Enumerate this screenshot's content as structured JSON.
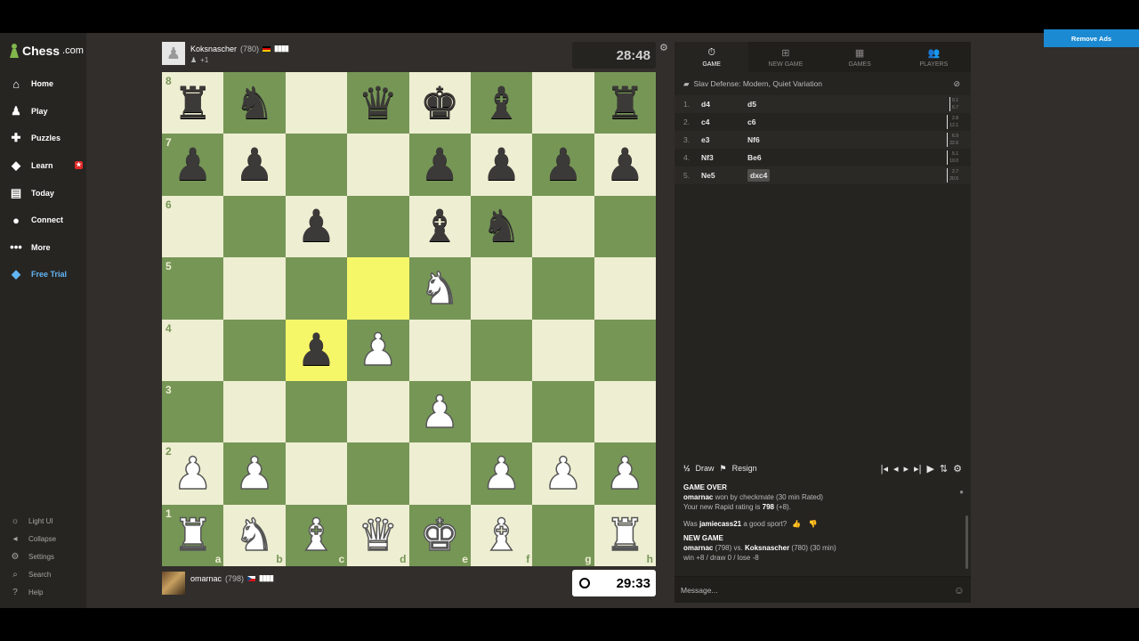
{
  "brand": {
    "name": "Chess",
    "suffix": ".com"
  },
  "nav": [
    {
      "icon": "home-icon",
      "glyph": "⌂",
      "label": "Home"
    },
    {
      "icon": "play-icon",
      "glyph": "♟",
      "label": "Play"
    },
    {
      "icon": "puzzles-icon",
      "glyph": "✚",
      "label": "Puzzles"
    },
    {
      "icon": "learn-icon",
      "glyph": "◆",
      "label": "Learn"
    },
    {
      "icon": "today-icon",
      "glyph": "▤",
      "label": "Today"
    },
    {
      "icon": "connect-icon",
      "glyph": "●",
      "label": "Connect"
    },
    {
      "icon": "more-icon",
      "glyph": "•••",
      "label": "More"
    },
    {
      "icon": "diamond-icon",
      "glyph": "◆",
      "label": "Free Trial"
    }
  ],
  "bottom_nav": [
    {
      "icon": "light-ui-icon",
      "glyph": "☼",
      "label": "Light UI"
    },
    {
      "icon": "collapse-icon",
      "glyph": "◂",
      "label": "Collapse"
    },
    {
      "icon": "settings-icon",
      "glyph": "⚙",
      "label": "Settings"
    },
    {
      "icon": "search-icon",
      "glyph": "⌕",
      "label": "Search"
    },
    {
      "icon": "help-icon",
      "glyph": "?",
      "label": "Help"
    }
  ],
  "opponent": {
    "name": "Koksnascher",
    "rating": "(780)",
    "bars": "▮▮▮▮",
    "captured": "+1",
    "clock": "28:48"
  },
  "player": {
    "name": "omarnac",
    "rating": "(798)",
    "bars": "▮▮▮▮",
    "clock": "29:33"
  },
  "board": {
    "ranks": [
      "8",
      "7",
      "6",
      "5",
      "4",
      "3",
      "2",
      "1"
    ],
    "files": [
      "a",
      "b",
      "c",
      "d",
      "e",
      "f",
      "g",
      "h"
    ],
    "position": [
      [
        "r",
        "n",
        ".",
        "q",
        "k",
        "b",
        ".",
        "r"
      ],
      [
        "p",
        "p",
        ".",
        ".",
        "p",
        "p",
        "p",
        "p"
      ],
      [
        ".",
        ".",
        "p",
        ".",
        "b",
        "n",
        ".",
        "."
      ],
      [
        ".",
        ".",
        ".",
        ".",
        "N",
        ".",
        ".",
        "."
      ],
      [
        ".",
        ".",
        "p",
        "P",
        ".",
        ".",
        ".",
        "."
      ],
      [
        ".",
        ".",
        ".",
        ".",
        "P",
        ".",
        ".",
        "."
      ],
      [
        "P",
        "P",
        ".",
        ".",
        ".",
        "P",
        "P",
        "P"
      ],
      [
        "R",
        "N",
        "B",
        "Q",
        "K",
        "B",
        ".",
        "R"
      ]
    ],
    "highlighted": [
      "c4",
      "d5"
    ],
    "colors": {
      "light": "#eeeed2",
      "dark": "#769656",
      "highlight": "#f6f669"
    }
  },
  "tabs": [
    {
      "icon": "clock-icon",
      "glyph": "⏱",
      "label": "GAME"
    },
    {
      "icon": "plus-icon",
      "glyph": "⊞",
      "label": "NEW GAME"
    },
    {
      "icon": "grid-icon",
      "glyph": "▦",
      "label": "GAMES"
    },
    {
      "icon": "players-icon",
      "glyph": "👥",
      "label": "PLAYERS"
    }
  ],
  "opening": "Slav Defense: Modern, Quiet Variation",
  "moves": [
    {
      "n": "1.",
      "w": "d4",
      "b": "d5",
      "ew": "0.1",
      "eb": "6.7"
    },
    {
      "n": "2.",
      "w": "c4",
      "b": "c6",
      "ew": "2.8",
      "eb": "12.1"
    },
    {
      "n": "3.",
      "w": "e3",
      "b": "Nf6",
      "ew": "6.9",
      "eb": "22.6"
    },
    {
      "n": "4.",
      "w": "Nf3",
      "b": "Be6",
      "ew": "5.1",
      "eb": "10.0"
    },
    {
      "n": "5.",
      "w": "Ne5",
      "b": "dxc4",
      "ew": "2.7",
      "eb": "20.5"
    }
  ],
  "controls": {
    "half": "½",
    "draw": "Draw",
    "resign": "Resign",
    "arrows": [
      "|◂",
      "◂",
      "▸",
      "▸|",
      "▶",
      "⇅",
      "⚙"
    ]
  },
  "chat": {
    "game_over": "GAME OVER",
    "winner": "omarnac",
    "result": " won by checkmate (30 min Rated)",
    "rating_prefix": "Your new Rapid rating is ",
    "rating_value": "798",
    "rating_suffix": " (+8).",
    "sport_prefix": "Was ",
    "sport_user": "jamiecass21",
    "sport_suffix": " a good sport?",
    "new_game": "NEW GAME",
    "ng_p1": "omarnac",
    "ng_mid1": " (798) vs. ",
    "ng_p2": "Koksnascher",
    "ng_mid2": " (780) (30 min)",
    "record": "win +8 / draw 0 / lose -8"
  },
  "message_placeholder": "Message...",
  "remove_ads": "Remove Ads"
}
